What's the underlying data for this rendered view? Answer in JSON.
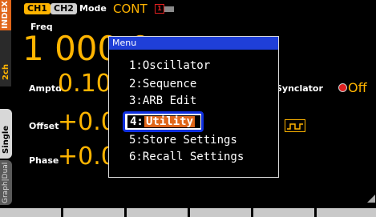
{
  "side_tabs": {
    "index": "INDEX",
    "channel": "2ch",
    "single": "Single",
    "graph_dual": "Graph|Dual"
  },
  "top_bar": {
    "ch1": "CH1",
    "ch2": "CH2",
    "mode_label": "Mode",
    "mode_value": "CONT",
    "status_icon": "1"
  },
  "params": {
    "freq_label": "Freq",
    "freq_value": "1 000.0",
    "amptd_label": "Amptd",
    "amptd_value": "0.10",
    "offset_label": "Offset",
    "offset_value": "+0.0",
    "phase_label": "Phase",
    "phase_value": "+0.0"
  },
  "right": {
    "synclator_label": "Synclator",
    "synclator_value": "Off",
    "partial_text": "e",
    "wave_icon": "square-wave-icon"
  },
  "menu": {
    "title": "Menu",
    "items": [
      {
        "num": "1:",
        "label": "Oscillator"
      },
      {
        "num": "2:",
        "label": "Sequence"
      },
      {
        "num": "3:",
        "label": "ARB Edit"
      },
      {
        "num": "4:",
        "label": "Utility"
      },
      {
        "num": "5:",
        "label": "Store Settings"
      },
      {
        "num": "6:",
        "label": "Recall Settings"
      }
    ],
    "selected_index": 3
  },
  "colors": {
    "accent": "#ffb400",
    "menu_title_bg": "#1f3fd8",
    "selection": "#e0661a",
    "highlight_border": "#1030e0"
  }
}
